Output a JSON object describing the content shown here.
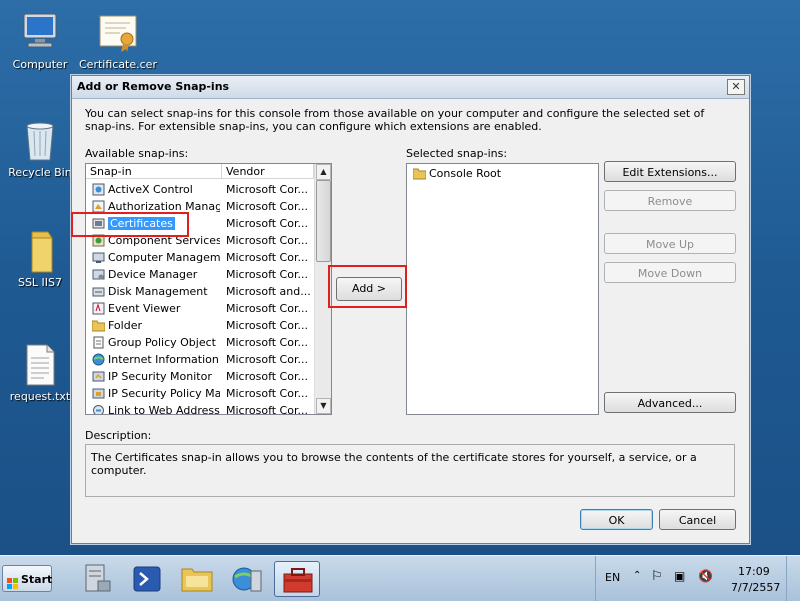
{
  "desktop": {
    "icons": [
      {
        "label": "Computer"
      },
      {
        "label": "Certificate.cer"
      },
      {
        "label": "Recycle Bin"
      },
      {
        "label": "SSL IIS7"
      },
      {
        "label": "request.txt"
      }
    ]
  },
  "dialog": {
    "title": "Add or Remove Snap-ins",
    "intro": "You can select snap-ins for this console from those available on your computer and configure the selected set of snap-ins. For extensible snap-ins, you can configure which extensions are enabled.",
    "available_label": "Available snap-ins:",
    "selected_label": "Selected snap-ins:",
    "columns": {
      "snapin": "Snap-in",
      "vendor": "Vendor"
    },
    "available": [
      {
        "name": "ActiveX Control",
        "vendor": "Microsoft Cor..."
      },
      {
        "name": "Authorization Manager",
        "vendor": "Microsoft Cor..."
      },
      {
        "name": "Certificates",
        "vendor": "Microsoft Cor...",
        "selected": true
      },
      {
        "name": "Component Services",
        "vendor": "Microsoft Cor..."
      },
      {
        "name": "Computer Managem...",
        "vendor": "Microsoft Cor..."
      },
      {
        "name": "Device Manager",
        "vendor": "Microsoft Cor..."
      },
      {
        "name": "Disk Management",
        "vendor": "Microsoft and..."
      },
      {
        "name": "Event Viewer",
        "vendor": "Microsoft Cor..."
      },
      {
        "name": "Folder",
        "vendor": "Microsoft Cor..."
      },
      {
        "name": "Group Policy Object ...",
        "vendor": "Microsoft Cor..."
      },
      {
        "name": "Internet Information...",
        "vendor": "Microsoft Cor..."
      },
      {
        "name": "IP Security Monitor",
        "vendor": "Microsoft Cor..."
      },
      {
        "name": "IP Security Policy Ma...",
        "vendor": "Microsoft Cor..."
      },
      {
        "name": "Link to Web Address",
        "vendor": "Microsoft Cor..."
      }
    ],
    "selected": [
      {
        "name": "Console Root"
      }
    ],
    "buttons": {
      "add": "Add >",
      "edit_extensions": "Edit Extensions...",
      "remove": "Remove",
      "move_up": "Move Up",
      "move_down": "Move Down",
      "advanced": "Advanced...",
      "ok": "OK",
      "cancel": "Cancel"
    },
    "description_label": "Description:",
    "description": "The Certificates snap-in allows you to browse the contents of the certificate stores for yourself, a service, or a computer."
  },
  "taskbar": {
    "start": "Start",
    "language": "EN",
    "time": "17:09",
    "date": "7/7/2557"
  },
  "colors": {
    "highlight": "#e0201f",
    "selection": "#3399ff"
  }
}
